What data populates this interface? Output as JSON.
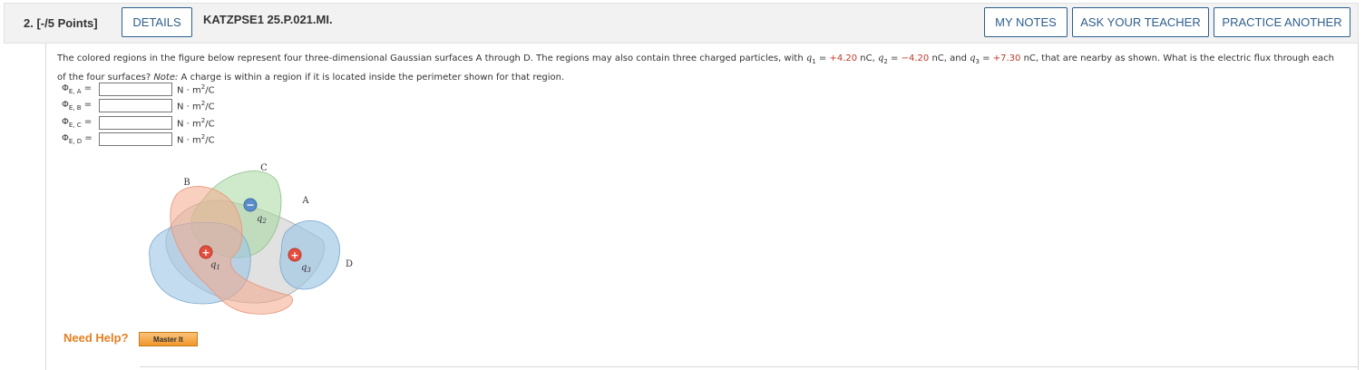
{
  "header": {
    "question_number": "2. [-/5 Points]",
    "details_label": "DETAILS",
    "question_code": "KATZPSE1 25.P.021.MI.",
    "my_notes_label": "MY NOTES",
    "ask_teacher_label": "ASK YOUR TEACHER",
    "practice_label": "PRACTICE ANOTHER"
  },
  "prompt": {
    "part1": "The colored regions in the figure below represent four three-dimensional Gaussian surfaces A through D. The regions may also contain three charged particles, with ",
    "q1_sym": "q",
    "q1_sub": "1",
    "q1_eq": " = ",
    "q1_val": "+4.20",
    "q1_unit": " nC,  ",
    "q2_sym": "q",
    "q2_sub": "2",
    "q2_eq": " = ",
    "q2_val": "−4.20",
    "q2_unit": " nC,  and  ",
    "q3_sym": "q",
    "q3_sub": "3",
    "q3_eq": " = ",
    "q3_val": "+7.30",
    "q3_unit": " nC,",
    "part2": "  that are nearby as shown. What is the electric flux through each of the four surfaces? ",
    "note_label": "Note:",
    "note_text": " A charge is within a region if it is located inside the perimeter shown for that region."
  },
  "answers": [
    {
      "phi": "Φ",
      "sub": "E, A",
      "eq": " =",
      "value": "",
      "unit_base": "N · m",
      "unit_sup": "2",
      "unit_tail": "/C"
    },
    {
      "phi": "Φ",
      "sub": "E, B",
      "eq": " =",
      "value": "",
      "unit_base": "N · m",
      "unit_sup": "2",
      "unit_tail": "/C"
    },
    {
      "phi": "Φ",
      "sub": "E, C",
      "eq": " =",
      "value": "",
      "unit_base": "N · m",
      "unit_sup": "2",
      "unit_tail": "/C"
    },
    {
      "phi": "Φ",
      "sub": "E, D",
      "eq": " =",
      "value": "",
      "unit_base": "N · m",
      "unit_sup": "2",
      "unit_tail": "/C"
    }
  ],
  "figure": {
    "label_a": "A",
    "label_b": "B",
    "label_c": "C",
    "label_d": "D",
    "q1_label": "q",
    "q1_sub": "1",
    "q2_label": "q",
    "q2_sub": "2",
    "q3_label": "q",
    "q3_sub": "3",
    "plus_sign": "+",
    "minus_sign": "−",
    "colors": {
      "region_a": "#c8c8c8",
      "region_b": "#f4a98c",
      "region_c": "#a8d8a0",
      "region_d": "#9cc4e4",
      "positive_charge": "#e74c3c",
      "negative_charge": "#5b8ec9"
    }
  },
  "help": {
    "need_help_label": "Need Help?",
    "master_it_label": "Master It"
  }
}
